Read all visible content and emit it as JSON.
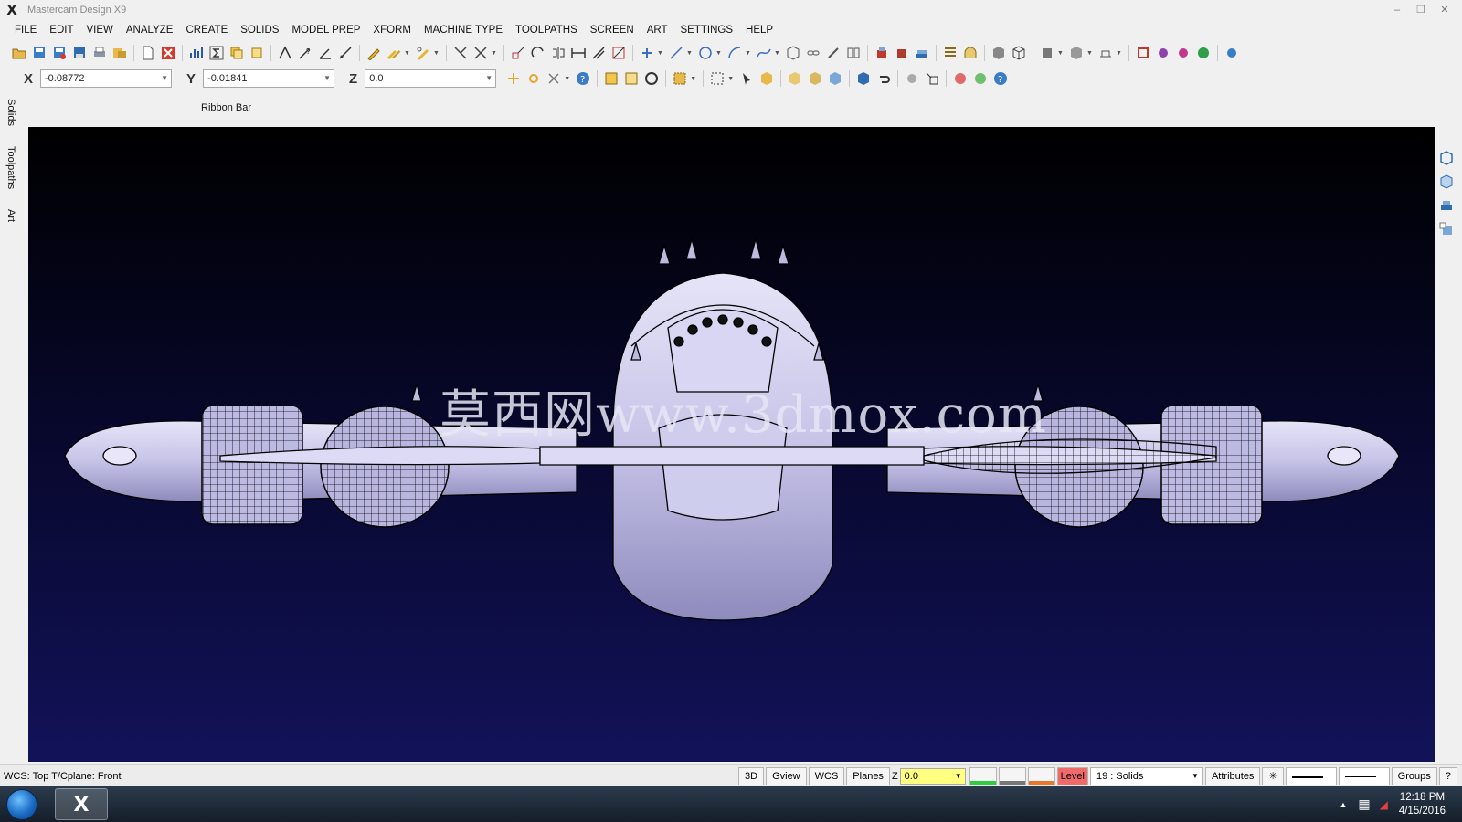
{
  "window": {
    "title": "Mastercam Design X9",
    "minimize": "–",
    "restore": "❐",
    "close": "✕"
  },
  "menu": [
    "FILE",
    "EDIT",
    "VIEW",
    "ANALYZE",
    "CREATE",
    "SOLIDS",
    "MODEL PREP",
    "XFORM",
    "MACHINE TYPE",
    "TOOLPATHS",
    "SCREEN",
    "ART",
    "SETTINGS",
    "HELP"
  ],
  "coords": {
    "x_label": "X",
    "x_value": "-0.08772",
    "y_label": "Y",
    "y_value": "-0.01841",
    "z_label": "Z",
    "z_value": "0.0"
  },
  "ribbon_bar_label": "Ribbon Bar",
  "side_tabs": [
    "Solids",
    "Toolpaths",
    "Art"
  ],
  "viewport": {
    "watermark": "莫西网www.3dmox.com",
    "background_top": "#000000",
    "background_bottom": "#121259",
    "model_fill": "#c9c6ea",
    "model_lines": "#000000"
  },
  "status": {
    "left_text": "WCS: Top  T/Cplane: Front",
    "btn_3d": "3D",
    "btn_gview": "Gview",
    "btn_wcs": "WCS",
    "btn_planes": "Planes",
    "z_label": "Z",
    "z_value": "0.0",
    "level_label": "Level",
    "level_value": "19 : Solids",
    "attributes": "Attributes",
    "point_style": "✳",
    "groups": "Groups",
    "help": "?"
  },
  "taskbar": {
    "app_icon": "X",
    "time": "12:18 PM",
    "date": "4/15/2016"
  },
  "icons": [
    "open-icon",
    "save-icon",
    "save-as-icon",
    "print-icon",
    "copy-icon",
    "new-icon",
    "close-red-icon",
    "merge-icon",
    "stats-icon",
    "layers-icon",
    "spline-icon",
    "measure-icon",
    "pencil-icon",
    "trim-icon",
    "plus-icon",
    "line-icon",
    "circle-icon",
    "arc-icon",
    "curve-icon",
    "cube-icon",
    "chain-icon",
    "solid-icon",
    "shade-icon",
    "settings-icon",
    "help-icon"
  ]
}
